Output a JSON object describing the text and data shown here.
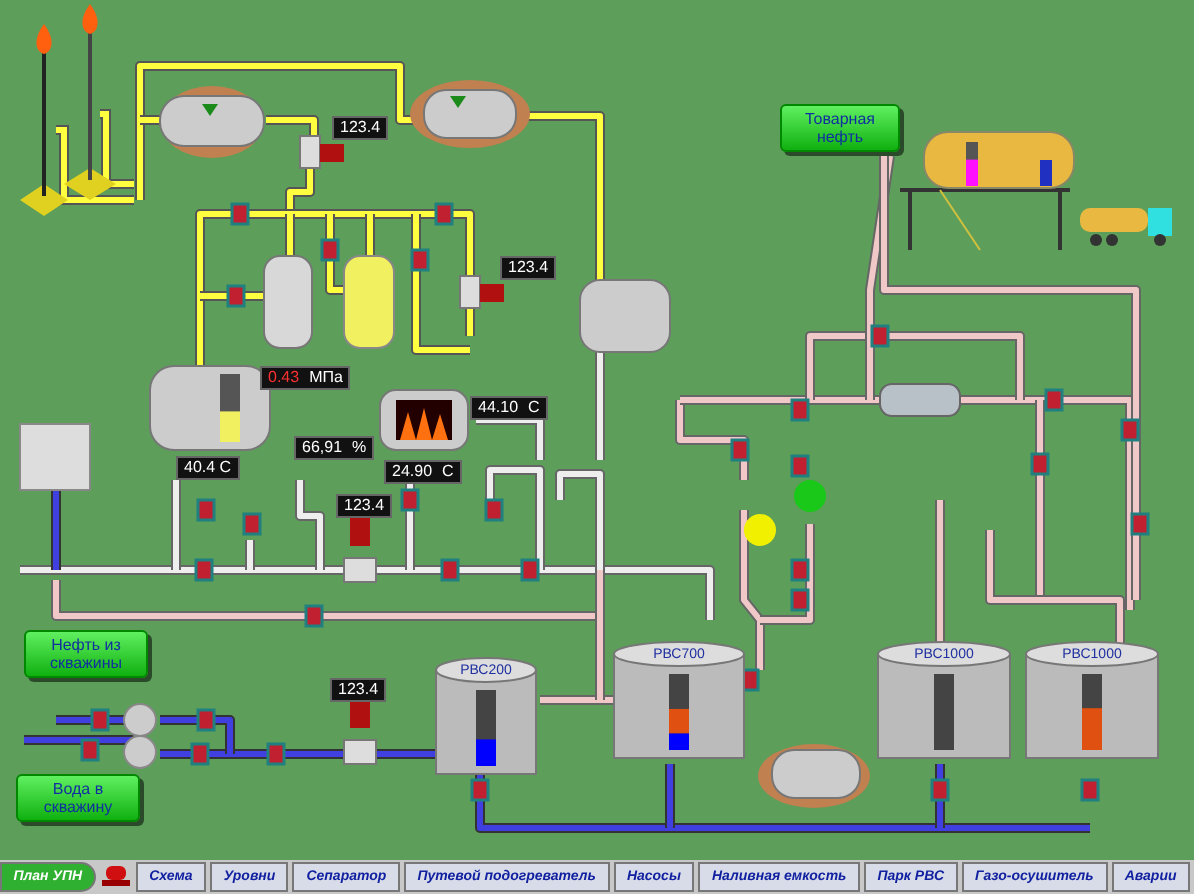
{
  "readings": [
    {
      "value": "123.4",
      "alarm": false
    },
    {
      "value": "123.4",
      "alarm": false
    },
    {
      "value": "0.43",
      "unit": "МПа",
      "alarm": true
    },
    {
      "value": "44.10",
      "unit": "C",
      "alarm": false
    },
    {
      "value": "66,91",
      "unit": "%",
      "alarm": false
    },
    {
      "value": "40.4 C",
      "alarm": false
    },
    {
      "value": "24.90",
      "unit": "C",
      "alarm": false
    },
    {
      "value": "123.4",
      "alarm": false
    },
    {
      "value": "123.4",
      "alarm": false
    }
  ],
  "nav_buttons": [
    {
      "label": "Товарная нефть"
    },
    {
      "label": "Нефть из скважины"
    },
    {
      "label": "Вода в скважину"
    }
  ],
  "separator": {
    "level": 0.45
  },
  "loading_tank": {
    "level": 0.6
  },
  "pumps": [
    {
      "color": "#f0f000"
    },
    {
      "color": "#19c819"
    }
  ],
  "tanks": [
    {
      "label": "РВС200",
      "layers": [
        {
          "level": 0.35,
          "color": "#0000ff"
        }
      ]
    },
    {
      "label": "РВС700",
      "layers": [
        {
          "level": 0.22,
          "color": "#0000ff"
        },
        {
          "level": 0.32,
          "color": "#e05010"
        }
      ]
    },
    {
      "label": "РВС1000"
    },
    {
      "label": "РВС1000",
      "layers": [
        {
          "level": 0.55,
          "color": "#e05010"
        }
      ]
    }
  ],
  "tabs": [
    {
      "label": "План УПН",
      "selected": true
    },
    {
      "label": "Схема",
      "selected": false
    },
    {
      "label": "Уровни",
      "selected": false
    },
    {
      "label": "Сепаратор",
      "selected": false
    },
    {
      "label": "Путевой подогреватель",
      "selected": false
    },
    {
      "label": "Насосы",
      "selected": false
    },
    {
      "label": "Наливная емкость",
      "selected": false
    },
    {
      "label": "Парк РВС",
      "selected": false
    },
    {
      "label": "Газо-осушитель",
      "selected": false
    },
    {
      "label": "Аварии",
      "selected": false
    }
  ]
}
